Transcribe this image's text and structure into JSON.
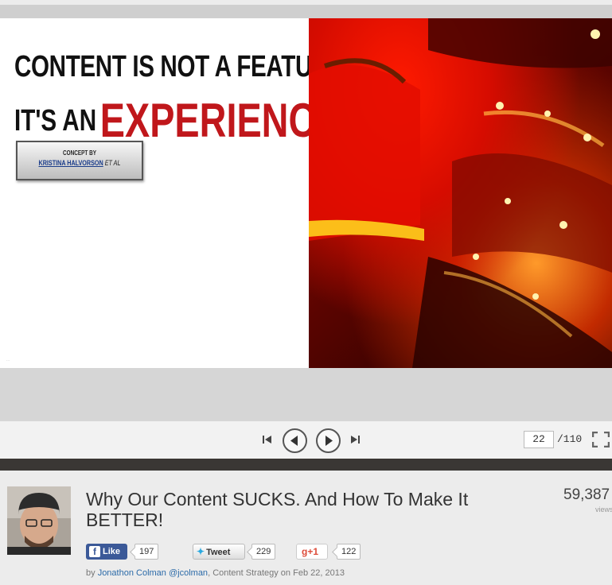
{
  "slide": {
    "headline_line1": "CONTENT IS NOT A FEATURE",
    "headline_line2_prefix": "IT'S AN",
    "headline_line2_accent": "EXPERIENCE",
    "concept_label": "CONCEPT BY",
    "concept_name": "KRISTINA HALVORSON",
    "concept_suffix": "ET AL",
    "accent_color": "#c0171b"
  },
  "player": {
    "current_page": "22",
    "total_pages": "/110",
    "icons": [
      "skip-to-start-icon",
      "previous-icon",
      "next-icon",
      "skip-to-end-icon",
      "fullscreen-icon"
    ]
  },
  "presentation": {
    "title": "Why Our Content SUCKS. And How To Make It BETTER!",
    "views_count": "59,387",
    "views_label": "views",
    "facebook": {
      "label": "Like",
      "count": "197"
    },
    "twitter": {
      "label": "Tweet",
      "count": "229"
    },
    "google_plus": {
      "label": "+1",
      "count": "122"
    },
    "byline": {
      "prefix": "by ",
      "author": "Jonathon Colman",
      "handle": "@jcolman",
      "category_sep": ", ",
      "category": "Content Strategy",
      "date_prefix": " on ",
      "date": "Feb 22, 2013"
    }
  },
  "colors": {
    "facebook_blue": "#3b5998",
    "twitter_blue": "#2aa9e0",
    "google_red": "#dd4b39",
    "link_blue": "#2b6aa8",
    "divider_dark": "#3a3734"
  }
}
